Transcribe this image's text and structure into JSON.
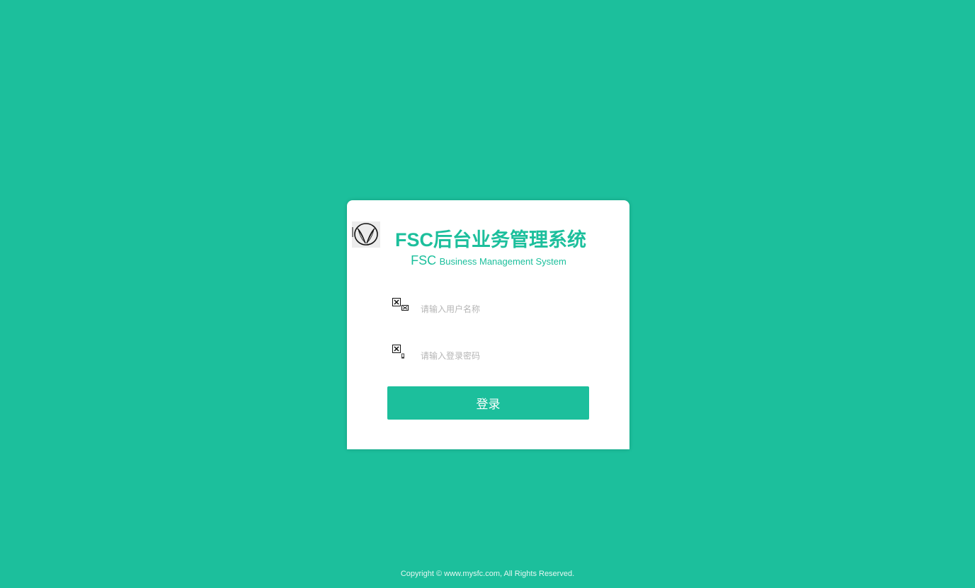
{
  "app": {
    "title": "FSC后台业务管理系统",
    "subtitle_prefix": "FSC",
    "subtitle_suffix": "Business Management System"
  },
  "login": {
    "username_placeholder": "请输入用户名称",
    "password_placeholder": "请输入登录密码",
    "submit_label": "登录"
  },
  "icons": {
    "logo": "v-leaf-logo-icon",
    "username": "broken-image-user-icon",
    "password": "broken-image-lock-icon"
  },
  "colors": {
    "brand": "#1cbf9c",
    "card": "#ffffff",
    "placeholder": "#b5b5b5"
  },
  "footer": {
    "copyright": "Copyright © www.mysfc.com, All Rights Reserved."
  }
}
